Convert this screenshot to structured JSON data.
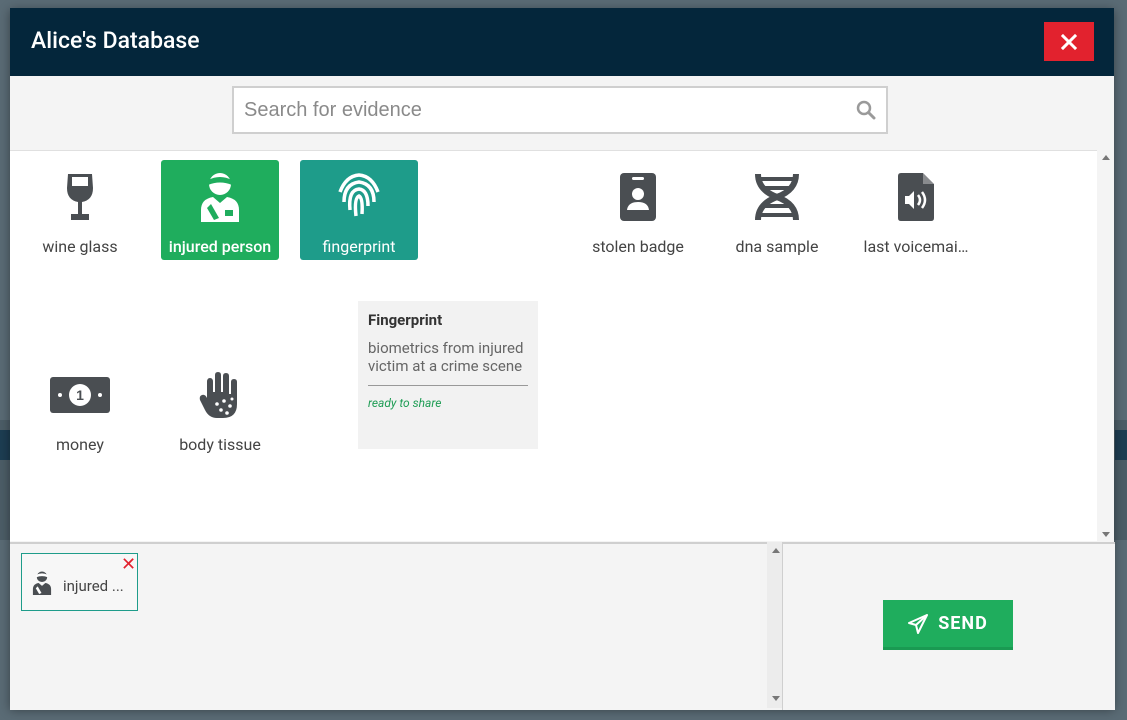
{
  "modal": {
    "title": "Alice's Database"
  },
  "search": {
    "placeholder": "Search for evidence",
    "value": ""
  },
  "evidence": [
    {
      "label": "wine glass",
      "icon": "wine-glass-icon",
      "state": "normal"
    },
    {
      "label": "injured person",
      "icon": "injured-person-icon",
      "state": "selected"
    },
    {
      "label": "fingerprint",
      "icon": "fingerprint-icon",
      "state": "hovered"
    },
    {
      "label": "",
      "icon": "",
      "state": "hidden"
    },
    {
      "label": "stolen badge",
      "icon": "badge-icon",
      "state": "normal"
    },
    {
      "label": "dna sample",
      "icon": "dna-icon",
      "state": "normal"
    },
    {
      "label": "last voicemai…",
      "icon": "voicemail-file-icon",
      "state": "normal"
    },
    {
      "label": "money",
      "icon": "money-icon",
      "state": "normal"
    },
    {
      "label": "body tissue",
      "icon": "body-tissue-hand-icon",
      "state": "normal"
    }
  ],
  "tooltip": {
    "title": "Fingerprint",
    "description": "biometrics from injured victim at a crime scene",
    "status": "ready to share"
  },
  "selection": [
    {
      "label": "injured ...",
      "icon": "injured-person-icon"
    }
  ],
  "send": {
    "label": "SEND"
  },
  "colors": {
    "header": "#04263b",
    "close": "#e2222e",
    "selected": "#1fad5d",
    "hover": "#1e9c8a"
  }
}
